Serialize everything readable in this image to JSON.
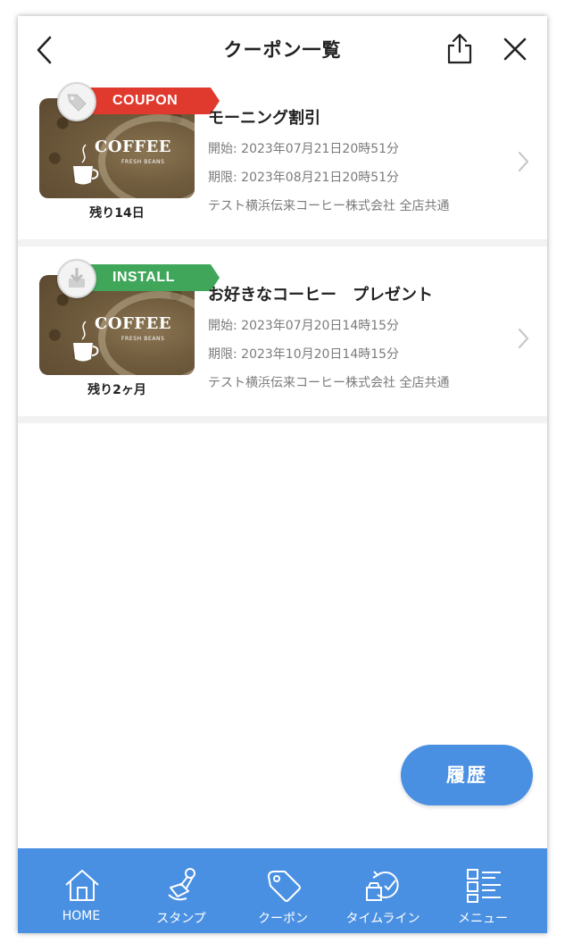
{
  "header": {
    "title": "クーポン一覧"
  },
  "coupons": [
    {
      "ribbon": "COUPON",
      "ribbon_color": "#e03a2f",
      "badge_icon": "tag-icon",
      "brand": "COFFEE",
      "brand_sub": "FRESH BEANS",
      "remaining": "残り14日",
      "title": "モーニング割引",
      "start": "開始: 2023年07月21日20時51分",
      "end": "期限: 2023年08月21日20時51分",
      "shop": "テスト横浜伝来コーヒー株式会社 全店共通"
    },
    {
      "ribbon": "INSTALL",
      "ribbon_color": "#3fa65a",
      "badge_icon": "download-icon",
      "brand": "COFFEE",
      "brand_sub": "FRESH BEANS",
      "remaining": "残り2ヶ月",
      "title": "お好きなコーヒー　プレゼント",
      "start": "開始: 2023年07月20日14時15分",
      "end": "期限: 2023年10月20日14時15分",
      "shop": "テスト横浜伝来コーヒー株式会社 全店共通"
    }
  ],
  "history_button": "履歴",
  "bottom_nav": [
    {
      "label": "HOME",
      "icon": "home-icon"
    },
    {
      "label": "スタンプ",
      "icon": "stamp-icon"
    },
    {
      "label": "クーポン",
      "icon": "coupon-tag-icon"
    },
    {
      "label": "タイムライン",
      "icon": "timeline-icon"
    },
    {
      "label": "メニュー",
      "icon": "menu-list-icon"
    }
  ],
  "colors": {
    "accent": "#4a90e2",
    "coupon_ribbon": "#e03a2f",
    "install_ribbon": "#3fa65a"
  }
}
